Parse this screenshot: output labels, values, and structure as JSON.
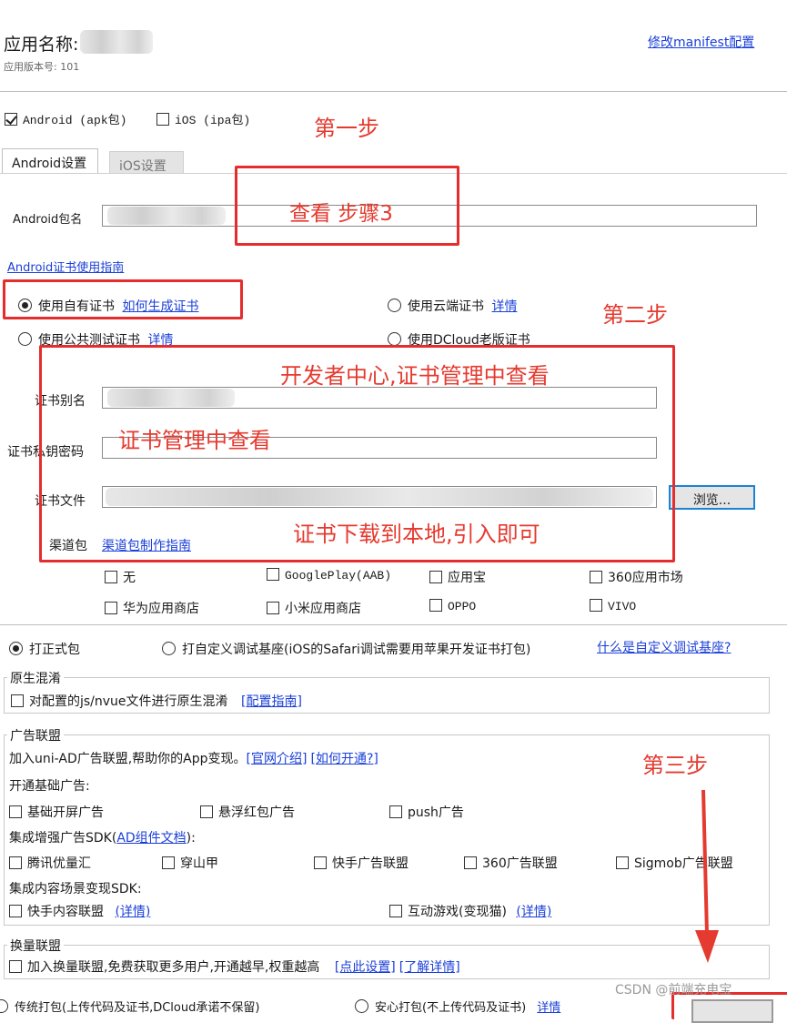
{
  "header": {
    "app_name_label": "应用名称:",
    "app_version": "应用版本号: 101",
    "edit_manifest_link": "修改manifest配置"
  },
  "platforms": {
    "android": "Android (apk包)",
    "ios": "iOS (ipa包)"
  },
  "tabs": [
    "Android设置",
    "iOS设置"
  ],
  "android": {
    "package_label": "Android包名",
    "cert_guide_link": "Android证书使用指南",
    "cert_options": {
      "own": "使用自有证书",
      "own_link": "如何生成证书",
      "cloud": "使用云端证书",
      "cloud_link": "详情",
      "public_test": "使用公共测试证书",
      "public_link": "详情",
      "dcloud_old": "使用DCloud老版证书"
    },
    "alias_label": "证书别名",
    "password_label": "证书私钥密码",
    "file_label": "证书文件",
    "browse_button": "浏览...",
    "channel_label": "渠道包",
    "channel_link": "渠道包制作指南",
    "channels": [
      "无",
      "GooglePlay(AAB)",
      "应用宝",
      "360应用市场",
      "华为应用商店",
      "小米应用商店",
      "OPPO",
      "VIVO"
    ]
  },
  "build_type": {
    "formal": "打正式包",
    "custom": "打自定义调试基座(iOS的Safari调试需要用苹果开发证书打包)",
    "custom_link": "什么是自定义调试基座?"
  },
  "obfuscation": {
    "title": "原生混淆",
    "option": "对配置的js/nvue文件进行原生混淆",
    "link": "[配置指南]"
  },
  "ads": {
    "title": "广告联盟",
    "intro": "加入uni-AD广告联盟,帮助你的App变现。",
    "intro_link1": "[官网介绍]",
    "intro_link2": "[如何开通?]",
    "basic_title": "开通基础广告:",
    "basic": [
      "基础开屏广告",
      "悬浮红包广告",
      "push广告"
    ],
    "enhanced_title_prefix": "集成增强广告SDK(",
    "enhanced_title_link": "AD组件文档",
    "enhanced_title_suffix": "):",
    "enhanced": [
      "腾讯优量汇",
      "穿山甲",
      "快手广告联盟",
      "360广告联盟",
      "Sigmob广告联盟"
    ],
    "content_title": "集成内容场景变现SDK:",
    "content_opt1": "快手内容联盟",
    "content_opt1_link": "(详情)",
    "content_opt2": "互动游戏(变现猫)",
    "content_opt2_link": "(详情)"
  },
  "exchange": {
    "title": "换量联盟",
    "option": "加入换量联盟,免费获取更多用户,开通越早,权重越高",
    "link1": "[点此设置]",
    "link2": "[了解详情]"
  },
  "bottom": {
    "opt1": "传统打包(上传代码及证书,DCloud承诺不保留)",
    "opt2": "安心打包(不上传代码及证书)",
    "link": "详情"
  },
  "annotations": {
    "step1": "第一步",
    "step2": "第二步",
    "step3": "第三步",
    "view_step3": "查看 步骤3",
    "dev_center": "开发者中心,证书管理中查看",
    "cert_mgmt": "证书管理中查看",
    "download_local": "证书下载到本地,引入即可"
  },
  "watermark": "CSDN @前端充电宝",
  "colors": {
    "link": "#1a3fd8",
    "annotation": "#e53a2f",
    "focus_border": "#1a83d6"
  }
}
